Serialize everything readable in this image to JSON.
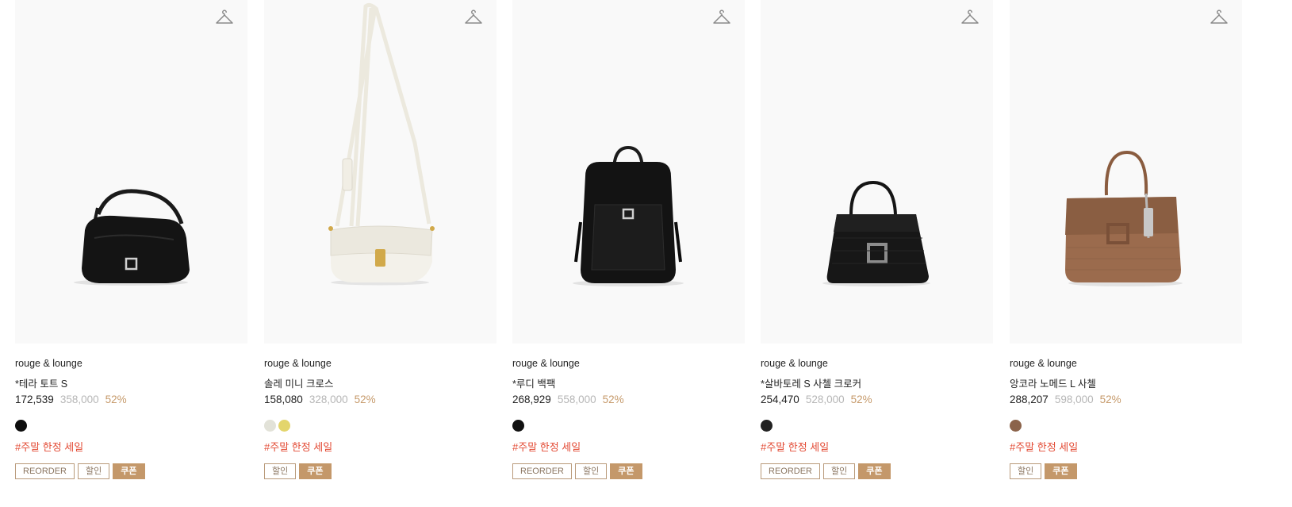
{
  "products": [
    {
      "brand": "rouge & lounge",
      "name": "*테라 토트 S",
      "sale_price": "172,539",
      "original_price": "358,000",
      "discount": "52%",
      "colors": [
        "#0e0e0e"
      ],
      "tagline": "#주말 한정 세일",
      "badges": {
        "reorder": "REORDER",
        "discount": "할인",
        "coupon": "쿠폰"
      },
      "image_icon": "black-shoulder-bag"
    },
    {
      "brand": "rouge & lounge",
      "name": "솔레 미니 크로스",
      "sale_price": "158,080",
      "original_price": "328,000",
      "discount": "52%",
      "colors": [
        "#e2e2d8",
        "#e3d56c"
      ],
      "tagline": "#주말 한정 세일",
      "badges": {
        "discount": "할인",
        "coupon": "쿠폰"
      },
      "image_icon": "ivory-crossbody-bag"
    },
    {
      "brand": "rouge & lounge",
      "name": "*루디 백팩",
      "sale_price": "268,929",
      "original_price": "558,000",
      "discount": "52%",
      "colors": [
        "#111111"
      ],
      "tagline": "#주말 한정 세일",
      "badges": {
        "reorder": "REORDER",
        "discount": "할인",
        "coupon": "쿠폰"
      },
      "image_icon": "black-backpack"
    },
    {
      "brand": "rouge & lounge",
      "name": "*살바토레 S 사첼 크로커",
      "sale_price": "254,470",
      "original_price": "528,000",
      "discount": "52%",
      "colors": [
        "#222222"
      ],
      "tagline": "#주말 한정 세일",
      "badges": {
        "reorder": "REORDER",
        "discount": "할인",
        "coupon": "쿠폰"
      },
      "image_icon": "black-croc-satchel"
    },
    {
      "brand": "rouge & lounge",
      "name": "앙코라 노메드 L 사첼",
      "sale_price": "288,207",
      "original_price": "598,000",
      "discount": "52%",
      "colors": [
        "#8b634a"
      ],
      "tagline": "#주말 한정 세일",
      "badges": {
        "discount": "할인",
        "coupon": "쿠폰"
      },
      "image_icon": "brown-woven-satchel"
    }
  ]
}
